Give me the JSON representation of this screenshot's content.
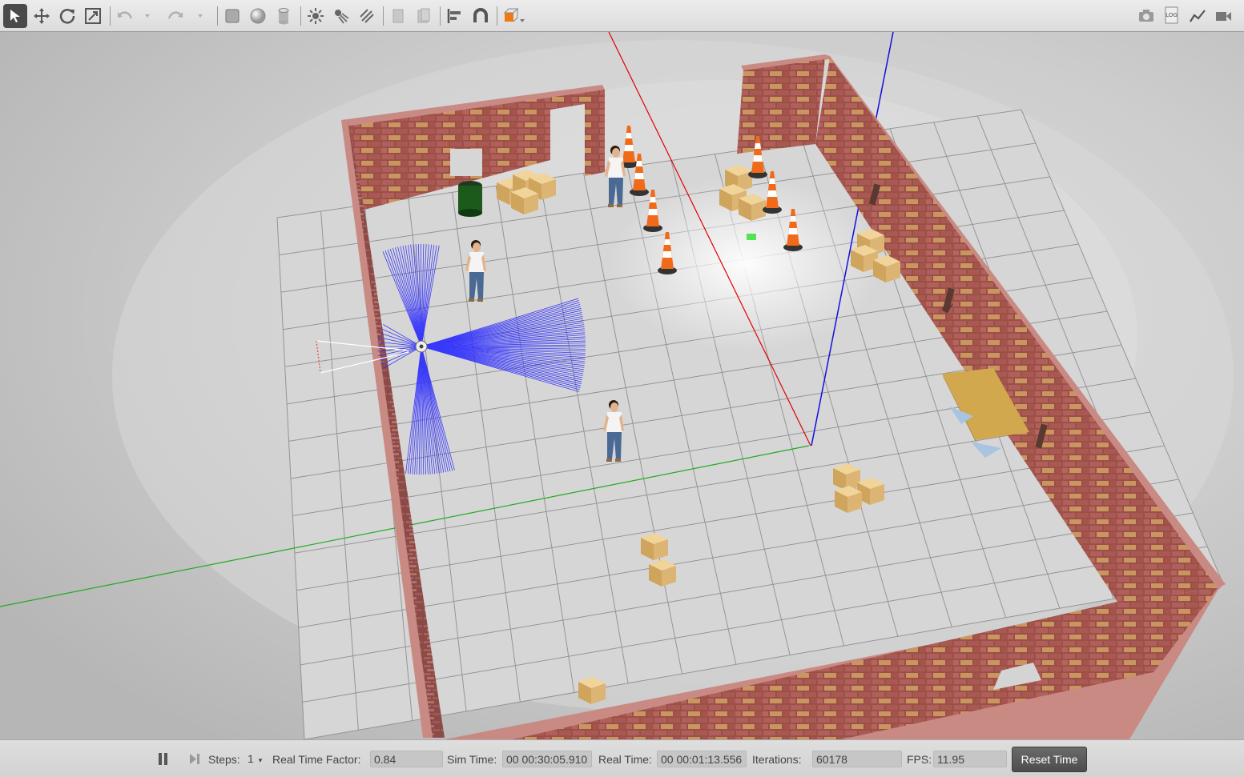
{
  "toolbar": {
    "left_tools": [
      {
        "name": "select-mode-icon",
        "state": "active"
      },
      {
        "name": "translate-mode-icon"
      },
      {
        "name": "rotate-mode-icon"
      },
      {
        "name": "scale-mode-icon"
      },
      {
        "name": "undo-icon",
        "state": "disabled"
      },
      {
        "name": "undo-dropdown-icon",
        "state": "disabled"
      },
      {
        "name": "redo-icon",
        "state": "disabled"
      },
      {
        "name": "redo-dropdown-icon",
        "state": "disabled"
      },
      {
        "name": "box-shape-icon"
      },
      {
        "name": "sphere-shape-icon"
      },
      {
        "name": "cylinder-shape-icon"
      },
      {
        "name": "point-light-icon"
      },
      {
        "name": "spot-light-icon"
      },
      {
        "name": "directional-light-icon"
      },
      {
        "name": "copy-icon",
        "state": "disabled"
      },
      {
        "name": "paste-icon",
        "state": "disabled"
      },
      {
        "name": "align-icon"
      },
      {
        "name": "snap-icon"
      },
      {
        "name": "view-angle-icon"
      }
    ],
    "right_tools": [
      {
        "name": "screenshot-icon"
      },
      {
        "name": "log-icon",
        "text": "LOG"
      },
      {
        "name": "plot-icon"
      },
      {
        "name": "video-record-icon"
      }
    ]
  },
  "status": {
    "steps_label": "Steps:",
    "steps_value": "1",
    "rtf_label": "Real Time Factor:",
    "rtf_value": "0.84",
    "sim_time_label": "Sim Time:",
    "sim_time_value": "00 00:30:05.910",
    "real_time_label": "Real Time:",
    "real_time_value": "00 00:01:13.556",
    "iterations_label": "Iterations:",
    "iterations_value": "60178",
    "fps_label": "FPS:",
    "fps_value": "11.95",
    "reset_label": "Reset Time"
  },
  "colors": {
    "brick": "#a0524a",
    "floor": "#d2d2d2",
    "laser": "#2a2aff",
    "cone": "#f06a1a",
    "box": "#d9b46a",
    "x_axis": "#e00000",
    "y_axis": "#22aa22",
    "z_axis": "#1010e0"
  }
}
